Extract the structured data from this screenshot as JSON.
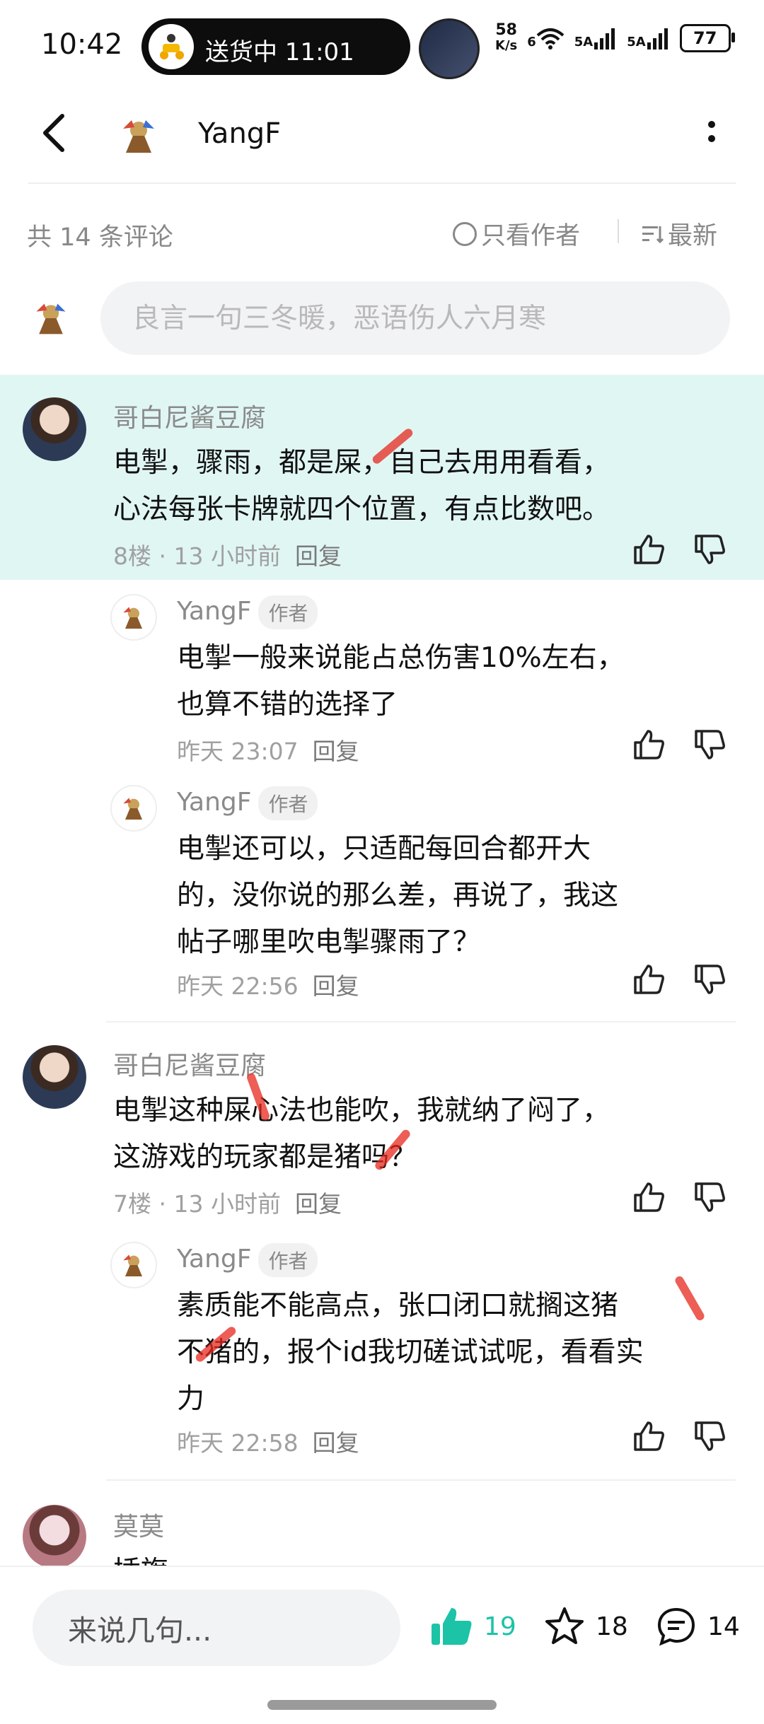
{
  "status_bar": {
    "time": "10:42",
    "pill_text": "送货中 11:01",
    "net_speed_value": "58",
    "net_speed_unit": "K/s",
    "wifi_label": "6",
    "sim1_label": "5A",
    "sim2_label": "5A",
    "battery": "77"
  },
  "header": {
    "title": "YangF"
  },
  "filter": {
    "count_text": "共 14 条评论",
    "author_only": "只看作者",
    "sort_latest": "最新"
  },
  "input": {
    "placeholder": "良言一句三冬暖，恶语伤人六月寒"
  },
  "comments": [
    {
      "user": "哥白尼酱豆腐",
      "text_line1": "电掣，骤雨，都是屎，自己去用用看看，",
      "text_line2": "心法每张卡牌就四个位置，有点比数吧。",
      "meta": "8楼 · 13 小时前",
      "reply_label": "回复",
      "replies": [
        {
          "user": "YangF",
          "tag": "作者",
          "text_line1": "电掣一般来说能占总伤害10%左右，",
          "text_line2": "也算不错的选择了",
          "meta": "昨天 23:07",
          "reply_label": "回复"
        },
        {
          "user": "YangF",
          "tag": "作者",
          "text_line1": "电掣还可以，只适配每回合都开大",
          "text_line2": "的，没你说的那么差，再说了，我这",
          "text_line3": "帖子哪里吹电掣骤雨了？",
          "meta": "昨天 22:56",
          "reply_label": "回复"
        }
      ]
    },
    {
      "user": "哥白尼酱豆腐",
      "text_line1": "电掣这种屎心法也能吹，我就纳了闷了，",
      "text_line2": "这游戏的玩家都是猪吗？",
      "meta": "7楼 · 13 小时前",
      "reply_label": "回复",
      "replies": [
        {
          "user": "YangF",
          "tag": "作者",
          "text_line1": "素质能不能高点，张口闭口就搁这猪",
          "text_line2": "不猪的，报个id我切磋试试呢，看看实",
          "text_line3": "力",
          "meta": "昨天 22:58",
          "reply_label": "回复"
        }
      ]
    },
    {
      "user": "莫莫",
      "text_line1": "插旗"
    }
  ],
  "bottom_bar": {
    "comment_placeholder": "来说几句...",
    "like_count": "19",
    "star_count": "18",
    "comment_count": "14"
  },
  "colors": {
    "accent": "#1cc3a6",
    "highlight_bg": "#e0f6f3",
    "muted_text": "#888888"
  }
}
